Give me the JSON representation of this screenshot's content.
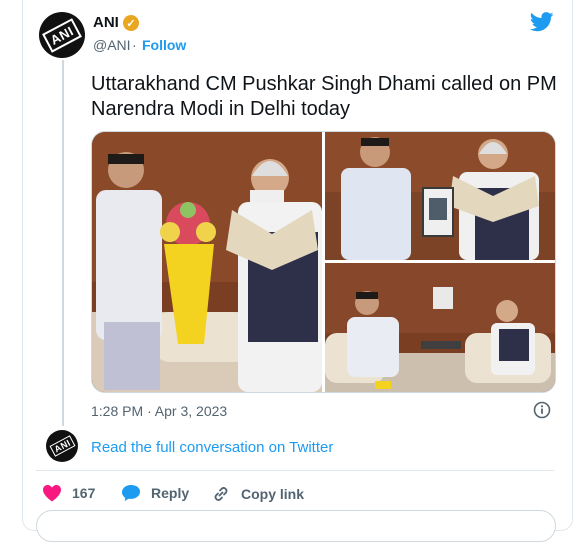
{
  "tweet": {
    "author_name": "ANI",
    "author_handle": "@ANI",
    "follow_label": "Follow",
    "separator": "·",
    "avatar_text": "ANI",
    "text": "Uttarakhand CM Pushkar Singh Dhami called on PM Narendra Modi in Delhi today",
    "timestamp": "1:28 PM · Apr 3, 2023",
    "read_conversation": "Read the full conversation on Twitter"
  },
  "actions": {
    "like_count": "167",
    "reply_label": "Reply",
    "copy_link_label": "Copy link"
  },
  "icons": [
    "verified-badge-icon",
    "twitter-bird-icon",
    "info-icon",
    "heart-icon",
    "reply-bubble-icon",
    "link-icon"
  ],
  "colors": {
    "accent": "#1d9bf0",
    "like": "#f91880",
    "verified": "#e8a621",
    "muted": "#536471"
  }
}
